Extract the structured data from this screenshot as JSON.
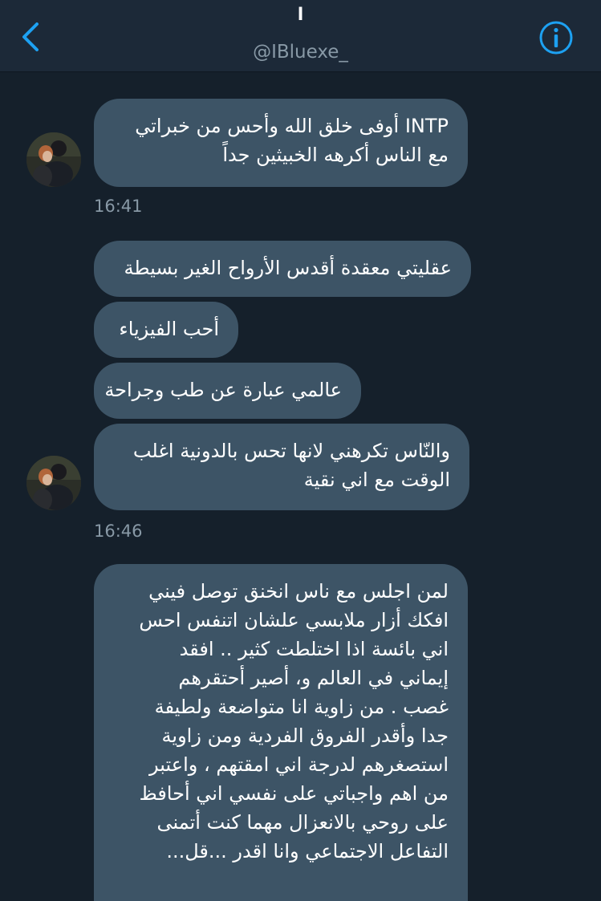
{
  "colors": {
    "background": "#15202b",
    "header_background": "#1c2938",
    "bubble": "#3d5466",
    "accent": "#1da1f2",
    "muted_text": "#8899a6"
  },
  "header": {
    "display_name": "ا",
    "handle": "@IBluexe_",
    "back_icon": "chevron-left-icon",
    "info_icon": "info-circle-icon"
  },
  "messages": [
    {
      "group": 1,
      "lines": [
        "INTP أوفى خلق الله وأحس من خبراتي",
        "مع الناس أكرهه الخبيثين جداً"
      ]
    },
    {
      "group": 1,
      "time": "16:41"
    },
    {
      "group": 2,
      "lines": [
        "عقليتي معقدة أقدس الأرواح الغير بسيطة"
      ]
    },
    {
      "group": 2,
      "lines": [
        "أحب الفيزياء"
      ]
    },
    {
      "group": 2,
      "lines": [
        "عالمي عبارة عن طب وجراحة"
      ]
    },
    {
      "group": 2,
      "lines": [
        "والنّاس تكرهني لانها تحس بالدونية اغلب",
        "الوقت مع اني نقية"
      ]
    },
    {
      "group": 2,
      "time": "16:46"
    },
    {
      "group": 3,
      "lines": [
        "لمن اجلس مع ناس انخنق توصل فيني",
        "افكك أزار ملابسي علشان اتنفس احس",
        "اني بائسة اذا اختلطت كثير .. افقد",
        "إيماني في العالم و، أصير أحتقرهم",
        "غصب . من زاوية انا متواضعة ولطيفة",
        "جدا وأقدر الفروق الفردية ومن زاوية",
        "استصغرهم لدرجة اني امقتهم ، واعتبر",
        "من اهم واجباتي على نفسي اني أحافظ",
        "على روحي بالانعزال مهما كنت أتمنى",
        "التفاعل الاجتماعي وانا اقدر ...قل..."
      ]
    }
  ]
}
